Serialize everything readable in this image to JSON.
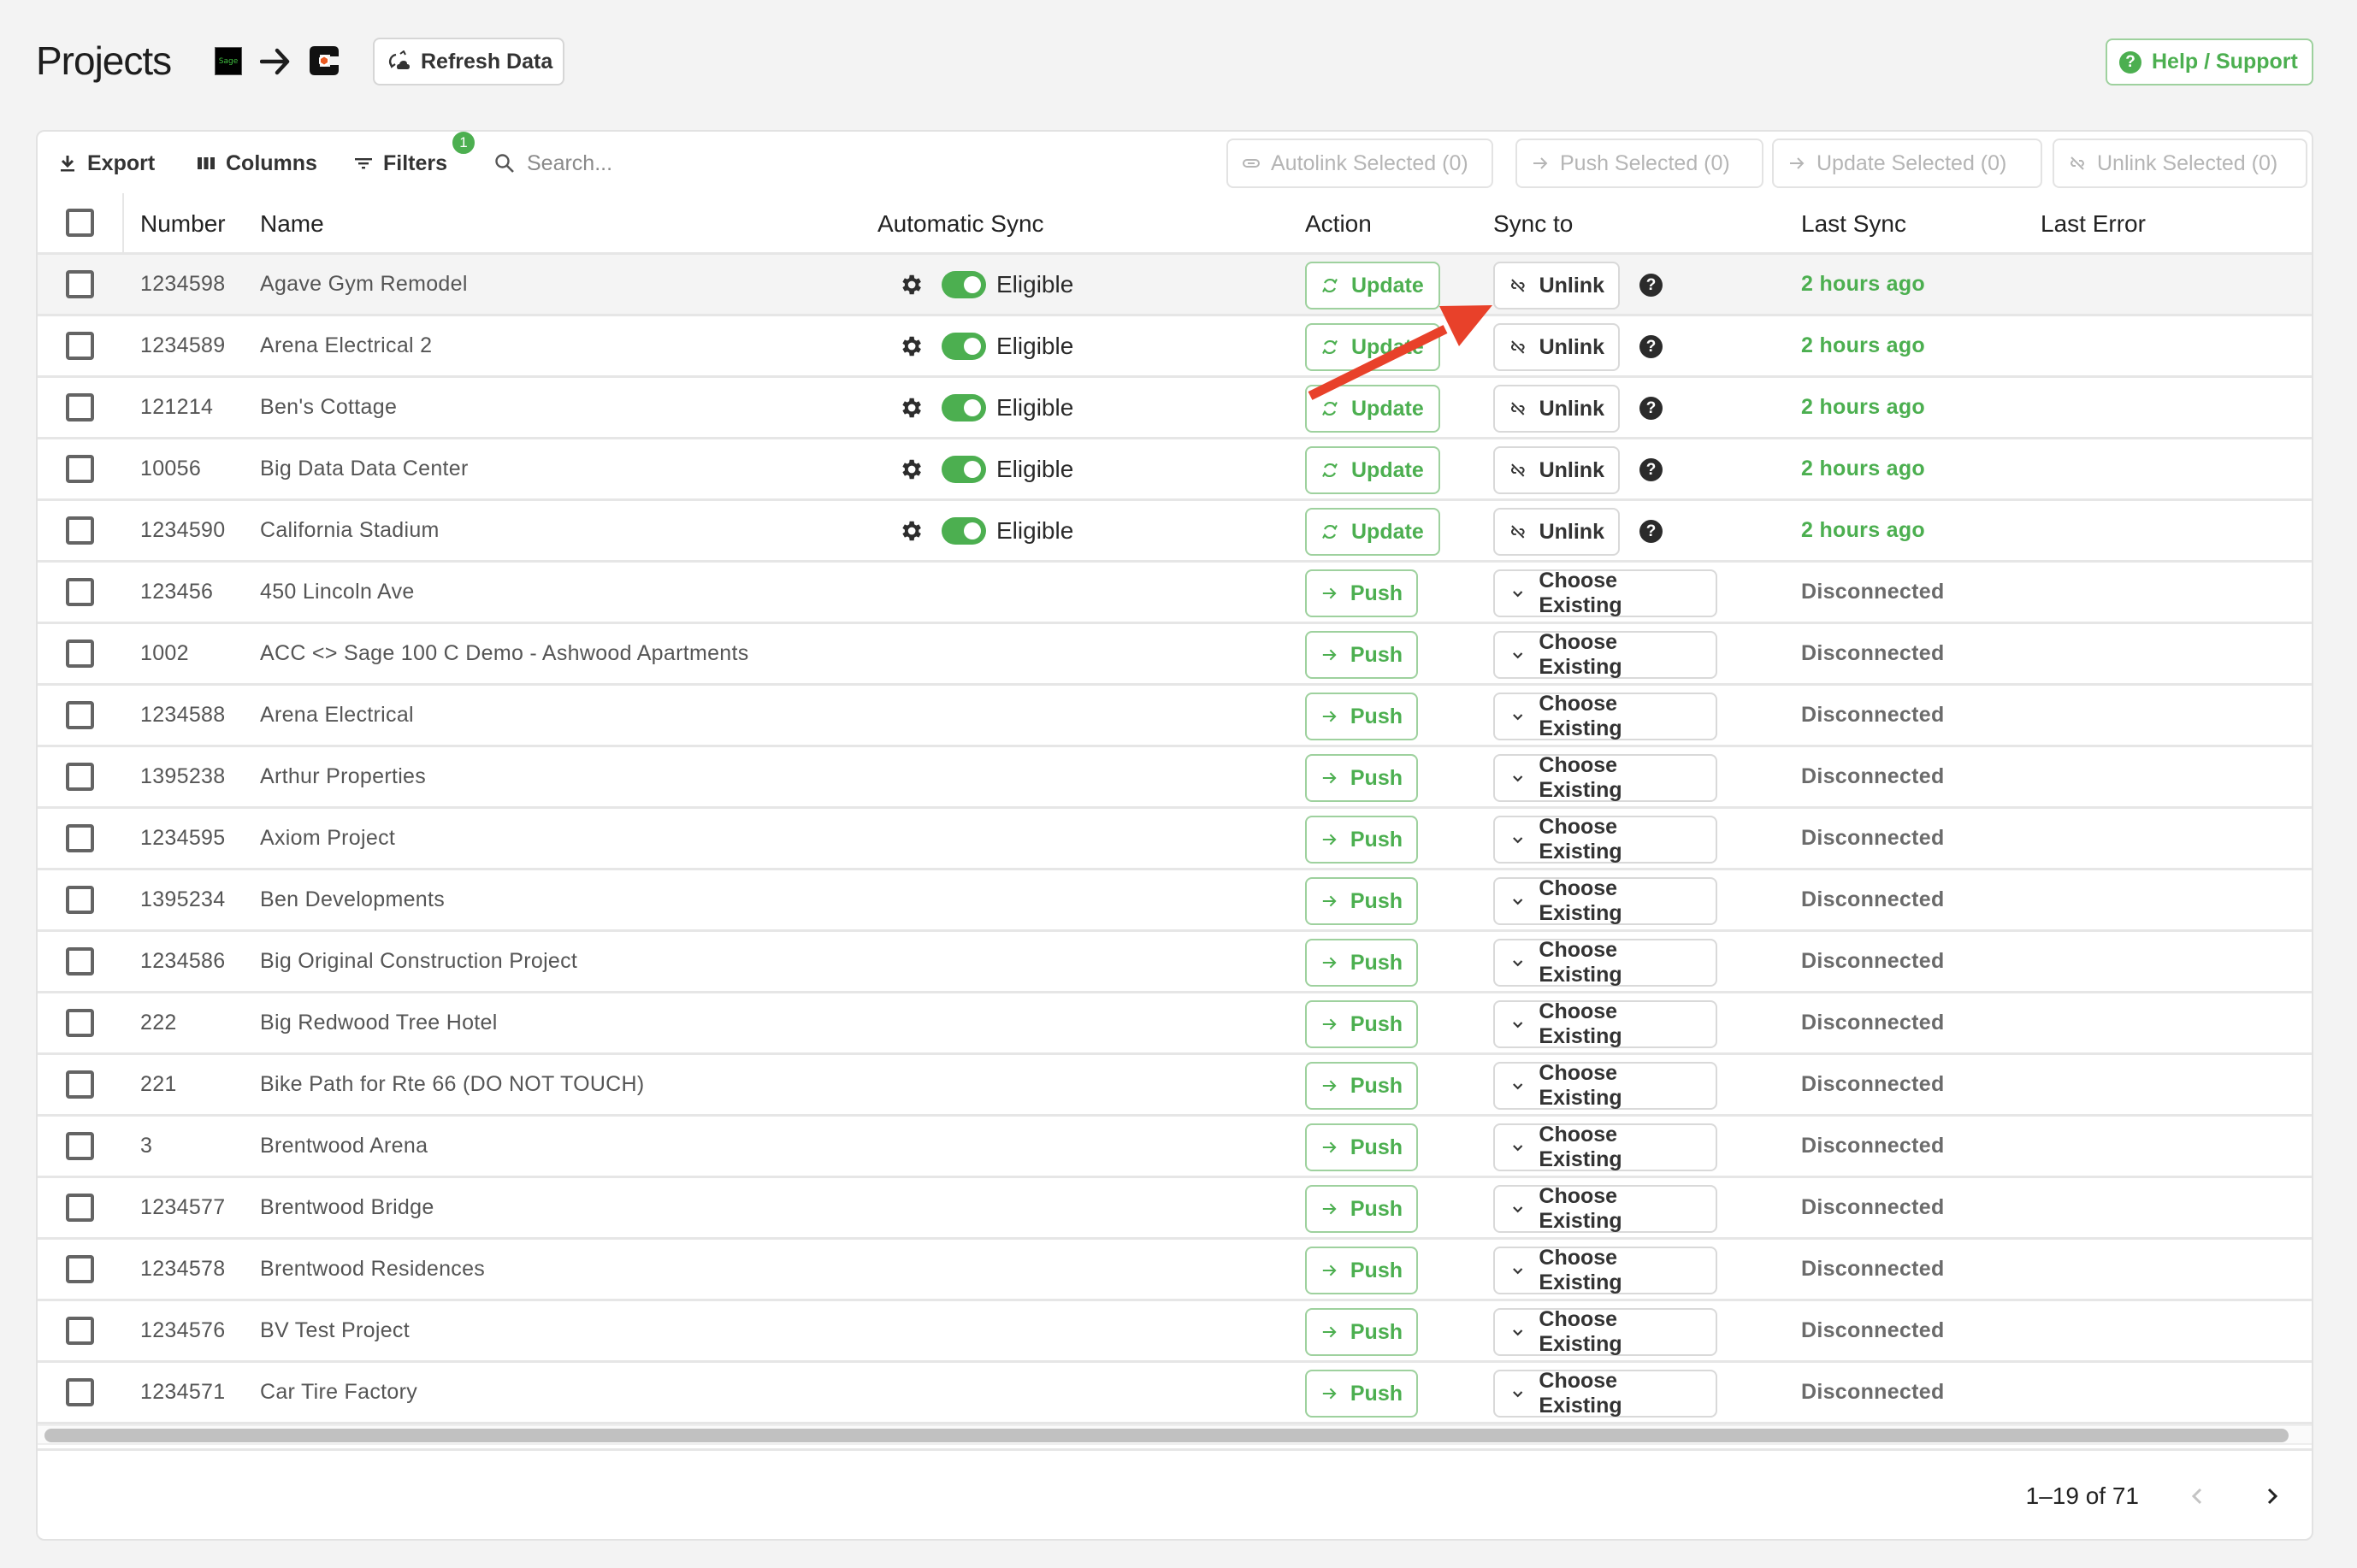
{
  "header": {
    "title": "Projects",
    "source_logo": "Sage",
    "flow_icon": "arrow-right-icon",
    "refresh_label": "Refresh Data",
    "help_label": "Help / Support",
    "help_icon": "?"
  },
  "toolbar": {
    "export_label": "Export",
    "columns_label": "Columns",
    "filters_label": "Filters",
    "filters_count": "1",
    "search_placeholder": "Search...",
    "bulk_actions": [
      {
        "label": "Autolink Selected (0)",
        "icon": "link-icon"
      },
      {
        "label": "Push Selected (0)",
        "icon": "arrow-right-icon"
      },
      {
        "label": "Update Selected (0)",
        "icon": "arrow-right-icon"
      },
      {
        "label": "Unlink Selected (0)",
        "icon": "unlink-icon"
      }
    ]
  },
  "table": {
    "columns": {
      "number": "Number",
      "name": "Name",
      "auto_sync": "Automatic Sync",
      "action": "Action",
      "sync_to": "Sync to",
      "last_sync": "Last Sync",
      "last_error": "Last Error"
    },
    "rows": [
      {
        "number": "1234598",
        "name": "Agave Gym Remodel",
        "auto_sync": "Eligible",
        "action": "Update",
        "sync_to": "Unlink",
        "last_sync": "2 hours ago",
        "last_error": ""
      },
      {
        "number": "1234589",
        "name": "Arena Electrical 2",
        "auto_sync": "Eligible",
        "action": "Update",
        "sync_to": "Unlink",
        "last_sync": "2 hours ago",
        "last_error": ""
      },
      {
        "number": "121214",
        "name": "Ben's Cottage",
        "auto_sync": "Eligible",
        "action": "Update",
        "sync_to": "Unlink",
        "last_sync": "2 hours ago",
        "last_error": ""
      },
      {
        "number": "10056",
        "name": "Big Data Data Center",
        "auto_sync": "Eligible",
        "action": "Update",
        "sync_to": "Unlink",
        "last_sync": "2 hours ago",
        "last_error": ""
      },
      {
        "number": "1234590",
        "name": "California Stadium",
        "auto_sync": "Eligible",
        "action": "Update",
        "sync_to": "Unlink",
        "last_sync": "2 hours ago",
        "last_error": ""
      },
      {
        "number": "123456",
        "name": "450 Lincoln Ave",
        "auto_sync": "",
        "action": "Push",
        "sync_to": "Choose Existing",
        "last_sync": "Disconnected",
        "last_error": ""
      },
      {
        "number": "1002",
        "name": "ACC <> Sage 100 C Demo - Ashwood Apartments",
        "auto_sync": "",
        "action": "Push",
        "sync_to": "Choose Existing",
        "last_sync": "Disconnected",
        "last_error": ""
      },
      {
        "number": "1234588",
        "name": "Arena Electrical",
        "auto_sync": "",
        "action": "Push",
        "sync_to": "Choose Existing",
        "last_sync": "Disconnected",
        "last_error": ""
      },
      {
        "number": "1395238",
        "name": "Arthur Properties",
        "auto_sync": "",
        "action": "Push",
        "sync_to": "Choose Existing",
        "last_sync": "Disconnected",
        "last_error": ""
      },
      {
        "number": "1234595",
        "name": "Axiom Project",
        "auto_sync": "",
        "action": "Push",
        "sync_to": "Choose Existing",
        "last_sync": "Disconnected",
        "last_error": ""
      },
      {
        "number": "1395234",
        "name": "Ben Developments",
        "auto_sync": "",
        "action": "Push",
        "sync_to": "Choose Existing",
        "last_sync": "Disconnected",
        "last_error": ""
      },
      {
        "number": "1234586",
        "name": "Big Original Construction Project",
        "auto_sync": "",
        "action": "Push",
        "sync_to": "Choose Existing",
        "last_sync": "Disconnected",
        "last_error": ""
      },
      {
        "number": "222",
        "name": "Big Redwood Tree Hotel",
        "auto_sync": "",
        "action": "Push",
        "sync_to": "Choose Existing",
        "last_sync": "Disconnected",
        "last_error": ""
      },
      {
        "number": "221",
        "name": "Bike Path for Rte 66 (DO NOT TOUCH)",
        "auto_sync": "",
        "action": "Push",
        "sync_to": "Choose Existing",
        "last_sync": "Disconnected",
        "last_error": ""
      },
      {
        "number": "3",
        "name": "Brentwood Arena",
        "auto_sync": "",
        "action": "Push",
        "sync_to": "Choose Existing",
        "last_sync": "Disconnected",
        "last_error": ""
      },
      {
        "number": "1234577",
        "name": "Brentwood Bridge",
        "auto_sync": "",
        "action": "Push",
        "sync_to": "Choose Existing",
        "last_sync": "Disconnected",
        "last_error": ""
      },
      {
        "number": "1234578",
        "name": "Brentwood Residences",
        "auto_sync": "",
        "action": "Push",
        "sync_to": "Choose Existing",
        "last_sync": "Disconnected",
        "last_error": ""
      },
      {
        "number": "1234576",
        "name": "BV Test Project",
        "auto_sync": "",
        "action": "Push",
        "sync_to": "Choose Existing",
        "last_sync": "Disconnected",
        "last_error": ""
      },
      {
        "number": "1234571",
        "name": "Car Tire Factory",
        "auto_sync": "",
        "action": "Push",
        "sync_to": "Choose Existing",
        "last_sync": "Disconnected",
        "last_error": ""
      }
    ]
  },
  "pagination": {
    "range_text": "1–19 of 71"
  },
  "colors": {
    "accent_green": "#4caf50",
    "annotation_red": "#e8412a",
    "disconnected_gray": "#6b6b6b"
  }
}
